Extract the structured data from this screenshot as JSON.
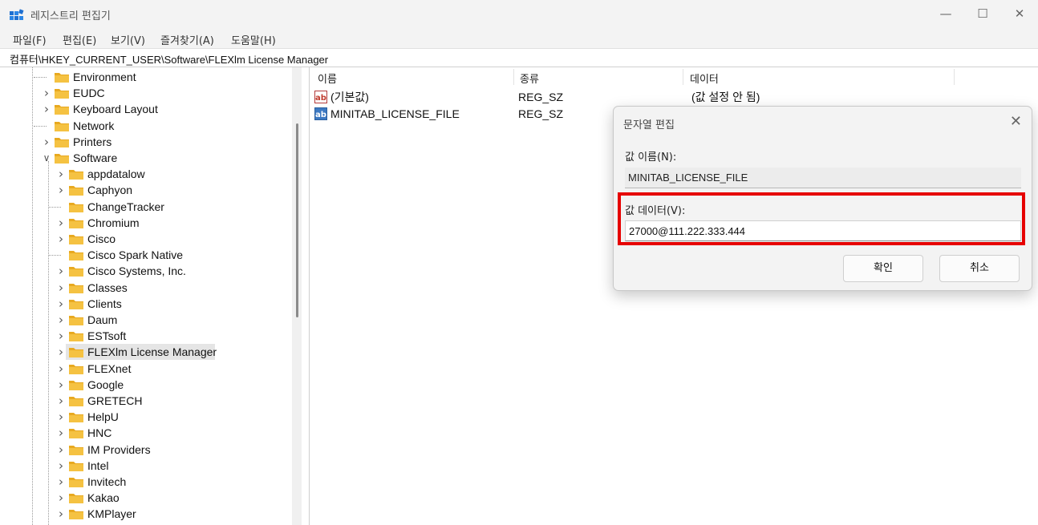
{
  "window": {
    "title": "레지스트리 편집기",
    "controls": {
      "minimize": "—",
      "maximize": "☐",
      "close": "✕"
    }
  },
  "menu": [
    "파일(F)",
    "편집(E)",
    "보기(V)",
    "즐겨찾기(A)",
    "도움말(H)"
  ],
  "address": "컴퓨터\\HKEY_CURRENT_USER\\Software\\FLEXlm License Manager",
  "tree": {
    "items": [
      {
        "label": "Environment",
        "level": 1,
        "expander": ""
      },
      {
        "label": "EUDC",
        "level": 1,
        "expander": ">"
      },
      {
        "label": "Keyboard Layout",
        "level": 1,
        "expander": ">"
      },
      {
        "label": "Network",
        "level": 1,
        "expander": ""
      },
      {
        "label": "Printers",
        "level": 1,
        "expander": ">"
      },
      {
        "label": "Software",
        "level": 1,
        "expander": "v"
      },
      {
        "label": "appdatalow",
        "level": 2,
        "expander": ">"
      },
      {
        "label": "Caphyon",
        "level": 2,
        "expander": ">"
      },
      {
        "label": "ChangeTracker",
        "level": 2,
        "expander": ""
      },
      {
        "label": "Chromium",
        "level": 2,
        "expander": ">"
      },
      {
        "label": "Cisco",
        "level": 2,
        "expander": ">"
      },
      {
        "label": "Cisco Spark Native",
        "level": 2,
        "expander": ""
      },
      {
        "label": "Cisco Systems, Inc.",
        "level": 2,
        "expander": ">"
      },
      {
        "label": "Classes",
        "level": 2,
        "expander": ">"
      },
      {
        "label": "Clients",
        "level": 2,
        "expander": ">"
      },
      {
        "label": "Daum",
        "level": 2,
        "expander": ">"
      },
      {
        "label": "ESTsoft",
        "level": 2,
        "expander": ">"
      },
      {
        "label": "FLEXlm License Manager",
        "level": 2,
        "expander": ">",
        "selected": true
      },
      {
        "label": "FLEXnet",
        "level": 2,
        "expander": ">"
      },
      {
        "label": "Google",
        "level": 2,
        "expander": ">"
      },
      {
        "label": "GRETECH",
        "level": 2,
        "expander": ">"
      },
      {
        "label": "HelpU",
        "level": 2,
        "expander": ">"
      },
      {
        "label": "HNC",
        "level": 2,
        "expander": ">"
      },
      {
        "label": "IM Providers",
        "level": 2,
        "expander": ">"
      },
      {
        "label": "Intel",
        "level": 2,
        "expander": ">"
      },
      {
        "label": "Invitech",
        "level": 2,
        "expander": ">"
      },
      {
        "label": "Kakao",
        "level": 2,
        "expander": ">"
      },
      {
        "label": "KMPlayer",
        "level": 2,
        "expander": ">"
      }
    ]
  },
  "list": {
    "columns": {
      "name": "이름",
      "type": "종류",
      "data": "데이터"
    },
    "rows": [
      {
        "name": "(기본값)",
        "type": "REG_SZ",
        "data": "(값 설정 안 됨)",
        "icon": "string-value-icon"
      },
      {
        "name": "MINITAB_LICENSE_FILE",
        "type": "REG_SZ",
        "data": "",
        "icon": "string-value-icon"
      }
    ]
  },
  "dialog": {
    "title": "문자열 편집",
    "close": "✕",
    "value_name_label": "값 이름(N):",
    "value_name": "MINITAB_LICENSE_FILE",
    "value_data_label": "값 데이터(V):",
    "value_data": "27000@111.222.333.444",
    "ok": "확인",
    "cancel": "취소"
  },
  "colors": {
    "highlight": "#e60000",
    "folder": "#f5c242",
    "selection": "#e5e5e5"
  }
}
